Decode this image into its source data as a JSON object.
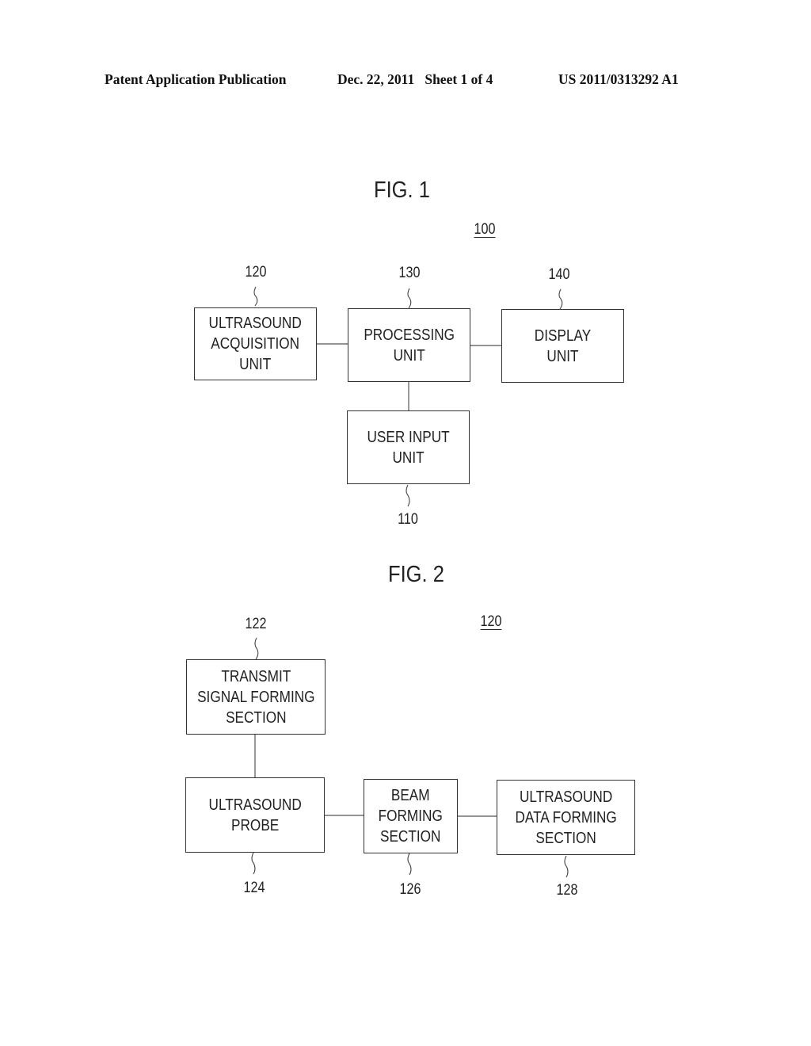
{
  "header": {
    "publication": "Patent Application Publication",
    "date_sheet": "Dec. 22, 2011   Sheet 1 of 4",
    "number": "US 2011/0313292 A1"
  },
  "fig1": {
    "title": "FIG. 1",
    "system_ref": "100",
    "blocks": [
      {
        "id": "ultrasound-acquisition-unit",
        "label": "ULTRASOUND\nACQUISITION\nUNIT",
        "ref": "120"
      },
      {
        "id": "processing-unit",
        "label": "PROCESSING\nUNIT",
        "ref": "130"
      },
      {
        "id": "display-unit",
        "label": "DISPLAY\nUNIT",
        "ref": "140"
      },
      {
        "id": "user-input-unit",
        "label": "USER INPUT\nUNIT",
        "ref": "110"
      }
    ]
  },
  "fig2": {
    "title": "FIG. 2",
    "system_ref": "120",
    "blocks": [
      {
        "id": "transmit-signal-forming-section",
        "label": "TRANSMIT\nSIGNAL FORMING\nSECTION",
        "ref": "122"
      },
      {
        "id": "ultrasound-probe",
        "label": "ULTRASOUND\nPROBE",
        "ref": "124"
      },
      {
        "id": "beam-forming-section",
        "label": "BEAM\nFORMING\nSECTION",
        "ref": "126"
      },
      {
        "id": "ultrasound-data-forming-section",
        "label": "ULTRASOUND\nDATA FORMING\nSECTION",
        "ref": "128"
      }
    ]
  }
}
